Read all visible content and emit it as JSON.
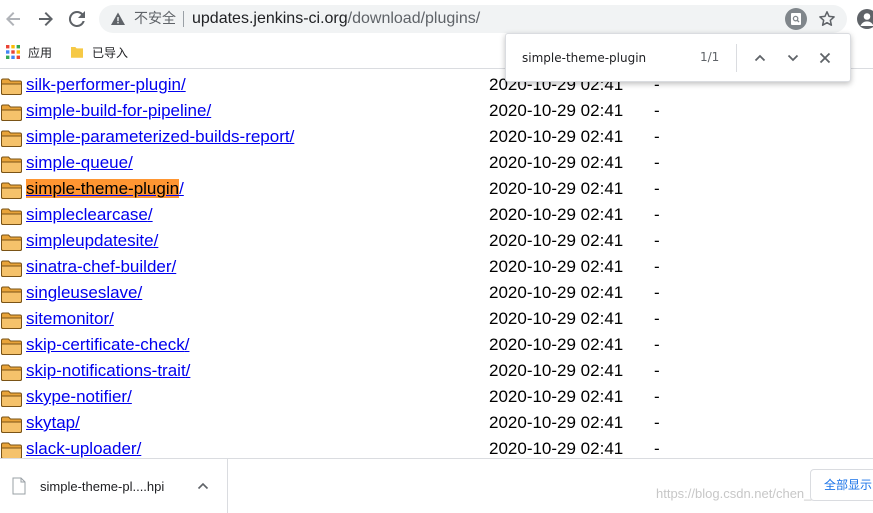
{
  "address_bar": {
    "security_label": "不安全",
    "url_host": "updates.jenkins-ci.org",
    "url_path": "/download/plugins/"
  },
  "bookmarks": {
    "apps_label": "应用",
    "imported_label": "已导入"
  },
  "find_bar": {
    "query": "simple-theme-plugin",
    "match_count": "1/1"
  },
  "listing": {
    "rows": [
      {
        "name": "silk-performer-plugin",
        "slash": "/",
        "date": "2020-10-29 02:41",
        "size": "-"
      },
      {
        "name": "simple-build-for-pipeline",
        "slash": "/",
        "date": "2020-10-29 02:41",
        "size": "-"
      },
      {
        "name": "simple-parameterized-builds-report",
        "slash": "/",
        "date": "2020-10-29 02:41",
        "size": "-"
      },
      {
        "name": "simple-queue",
        "slash": "/",
        "date": "2020-10-29 02:41",
        "size": "-"
      },
      {
        "name": "simple-theme-plugin",
        "slash": "/",
        "date": "2020-10-29 02:41",
        "size": "-",
        "highlighted": true
      },
      {
        "name": "simpleclearcase",
        "slash": "/",
        "date": "2020-10-29 02:41",
        "size": "-"
      },
      {
        "name": "simpleupdatesite",
        "slash": "/",
        "date": "2020-10-29 02:41",
        "size": "-"
      },
      {
        "name": "sinatra-chef-builder",
        "slash": "/",
        "date": "2020-10-29 02:41",
        "size": "-"
      },
      {
        "name": "singleuseslave",
        "slash": "/",
        "date": "2020-10-29 02:41",
        "size": "-"
      },
      {
        "name": "sitemonitor",
        "slash": "/",
        "date": "2020-10-29 02:41",
        "size": "-"
      },
      {
        "name": "skip-certificate-check",
        "slash": "/",
        "date": "2020-10-29 02:41",
        "size": "-"
      },
      {
        "name": "skip-notifications-trait",
        "slash": "/",
        "date": "2020-10-29 02:41",
        "size": "-"
      },
      {
        "name": "skype-notifier",
        "slash": "/",
        "date": "2020-10-29 02:41",
        "size": "-"
      },
      {
        "name": "skytap",
        "slash": "/",
        "date": "2020-10-29 02:41",
        "size": "-"
      },
      {
        "name": "slack-uploader",
        "slash": "/",
        "date": "2020-10-29 02:41",
        "size": "-"
      }
    ]
  },
  "download_shelf": {
    "file_name": "simple-theme-pl....hpi",
    "watermark": "https://blog.csdn.net/chen_wuz",
    "show_all_label": "全部显示"
  },
  "colors": {
    "link": "#0000ee",
    "find_highlight": "#ff9632",
    "folder_fill": "#f5c26b"
  }
}
